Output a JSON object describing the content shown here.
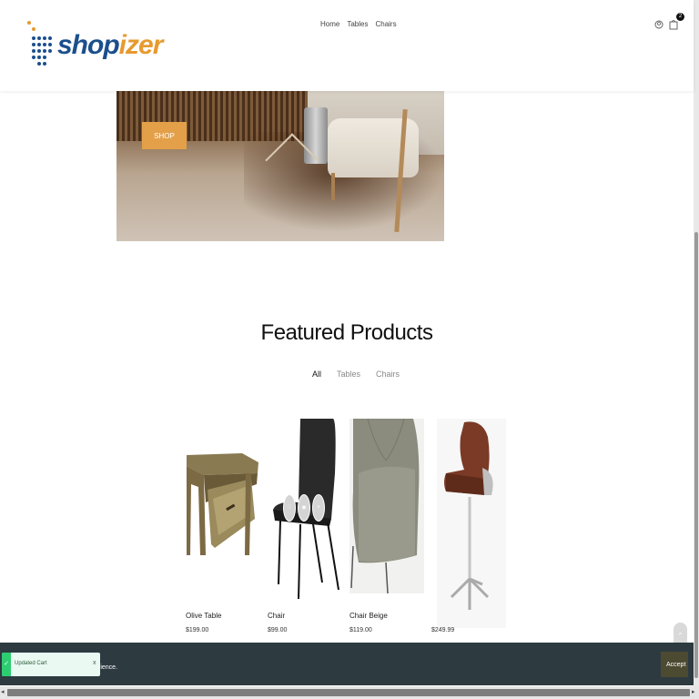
{
  "header": {
    "logo": {
      "part1": "shop",
      "part2": "izer"
    },
    "nav": [
      "Home",
      "Tables",
      "Chairs"
    ],
    "cart_count": "2",
    "icons": [
      "user-icon",
      "cart-icon"
    ]
  },
  "hero": {
    "cta": "SHOP"
  },
  "featured": {
    "title": "Featured Products",
    "tabs": [
      "All",
      "Tables",
      "Chairs"
    ],
    "active_tab": "All",
    "products": [
      {
        "name": "Olive Table",
        "price": "$199.00"
      },
      {
        "name": "Chair",
        "price": "$99.00"
      },
      {
        "name": "Chair Beige",
        "price": "$119.00"
      },
      {
        "name": "",
        "price": "$249.99"
      }
    ]
  },
  "cookie": {
    "text_fragment": "rience.",
    "accept_label": "Accept"
  },
  "toast": {
    "message": "Updated Cart",
    "close": "x",
    "check": "✓"
  },
  "scroll_top_icon": "chevron-up-icon",
  "colors": {
    "brand_blue": "#1b4f8c",
    "brand_orange": "#e79a2f",
    "cta_orange": "#e3a049",
    "cookie_bg": "#2d3a40",
    "toast_green": "#2ecc71"
  }
}
